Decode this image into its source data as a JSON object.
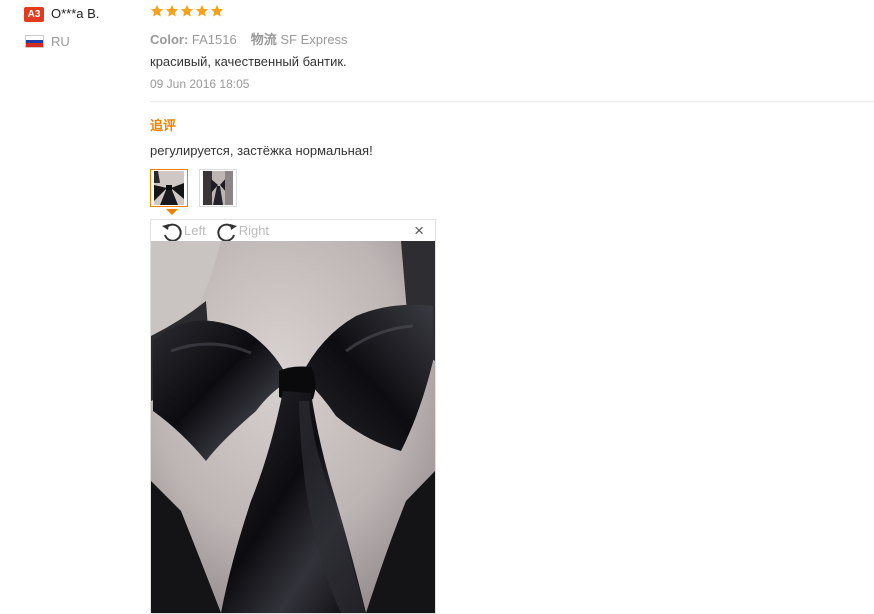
{
  "reviewer": {
    "level_badge": "A3",
    "name": "O***a B.",
    "country": "RU",
    "flag_colors": [
      "#ffffff",
      "#1c3fa6",
      "#d52b1e"
    ]
  },
  "review": {
    "rating": 5,
    "star_color": "#f7a21b",
    "color_label": "Color:",
    "color_value": "FA1516",
    "logistics_label": "物流",
    "logistics_value": "SF Express",
    "text": "красивый, качественный бантик.",
    "date": "09 Jun 2016 18:05"
  },
  "followup": {
    "label": "追评",
    "text": "регулируется, застёжка нормальная!",
    "accent": "#f08200"
  },
  "viewer": {
    "rotate_left_label": "Left",
    "rotate_right_label": "Right",
    "close_label": "×"
  }
}
